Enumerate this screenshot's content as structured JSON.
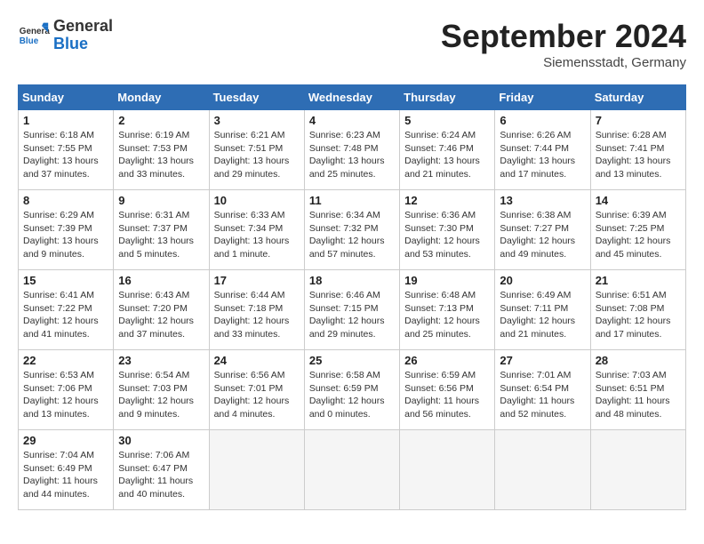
{
  "header": {
    "logo": {
      "general": "General",
      "blue": "Blue"
    },
    "month": "September 2024",
    "location": "Siemensstadt, Germany"
  },
  "days_of_week": [
    "Sunday",
    "Monday",
    "Tuesday",
    "Wednesday",
    "Thursday",
    "Friday",
    "Saturday"
  ],
  "weeks": [
    [
      {
        "num": "1",
        "info": "Sunrise: 6:18 AM\nSunset: 7:55 PM\nDaylight: 13 hours\nand 37 minutes."
      },
      {
        "num": "2",
        "info": "Sunrise: 6:19 AM\nSunset: 7:53 PM\nDaylight: 13 hours\nand 33 minutes."
      },
      {
        "num": "3",
        "info": "Sunrise: 6:21 AM\nSunset: 7:51 PM\nDaylight: 13 hours\nand 29 minutes."
      },
      {
        "num": "4",
        "info": "Sunrise: 6:23 AM\nSunset: 7:48 PM\nDaylight: 13 hours\nand 25 minutes."
      },
      {
        "num": "5",
        "info": "Sunrise: 6:24 AM\nSunset: 7:46 PM\nDaylight: 13 hours\nand 21 minutes."
      },
      {
        "num": "6",
        "info": "Sunrise: 6:26 AM\nSunset: 7:44 PM\nDaylight: 13 hours\nand 17 minutes."
      },
      {
        "num": "7",
        "info": "Sunrise: 6:28 AM\nSunset: 7:41 PM\nDaylight: 13 hours\nand 13 minutes."
      }
    ],
    [
      {
        "num": "8",
        "info": "Sunrise: 6:29 AM\nSunset: 7:39 PM\nDaylight: 13 hours\nand 9 minutes."
      },
      {
        "num": "9",
        "info": "Sunrise: 6:31 AM\nSunset: 7:37 PM\nDaylight: 13 hours\nand 5 minutes."
      },
      {
        "num": "10",
        "info": "Sunrise: 6:33 AM\nSunset: 7:34 PM\nDaylight: 13 hours\nand 1 minute."
      },
      {
        "num": "11",
        "info": "Sunrise: 6:34 AM\nSunset: 7:32 PM\nDaylight: 12 hours\nand 57 minutes."
      },
      {
        "num": "12",
        "info": "Sunrise: 6:36 AM\nSunset: 7:30 PM\nDaylight: 12 hours\nand 53 minutes."
      },
      {
        "num": "13",
        "info": "Sunrise: 6:38 AM\nSunset: 7:27 PM\nDaylight: 12 hours\nand 49 minutes."
      },
      {
        "num": "14",
        "info": "Sunrise: 6:39 AM\nSunset: 7:25 PM\nDaylight: 12 hours\nand 45 minutes."
      }
    ],
    [
      {
        "num": "15",
        "info": "Sunrise: 6:41 AM\nSunset: 7:22 PM\nDaylight: 12 hours\nand 41 minutes."
      },
      {
        "num": "16",
        "info": "Sunrise: 6:43 AM\nSunset: 7:20 PM\nDaylight: 12 hours\nand 37 minutes."
      },
      {
        "num": "17",
        "info": "Sunrise: 6:44 AM\nSunset: 7:18 PM\nDaylight: 12 hours\nand 33 minutes."
      },
      {
        "num": "18",
        "info": "Sunrise: 6:46 AM\nSunset: 7:15 PM\nDaylight: 12 hours\nand 29 minutes."
      },
      {
        "num": "19",
        "info": "Sunrise: 6:48 AM\nSunset: 7:13 PM\nDaylight: 12 hours\nand 25 minutes."
      },
      {
        "num": "20",
        "info": "Sunrise: 6:49 AM\nSunset: 7:11 PM\nDaylight: 12 hours\nand 21 minutes."
      },
      {
        "num": "21",
        "info": "Sunrise: 6:51 AM\nSunset: 7:08 PM\nDaylight: 12 hours\nand 17 minutes."
      }
    ],
    [
      {
        "num": "22",
        "info": "Sunrise: 6:53 AM\nSunset: 7:06 PM\nDaylight: 12 hours\nand 13 minutes."
      },
      {
        "num": "23",
        "info": "Sunrise: 6:54 AM\nSunset: 7:03 PM\nDaylight: 12 hours\nand 9 minutes."
      },
      {
        "num": "24",
        "info": "Sunrise: 6:56 AM\nSunset: 7:01 PM\nDaylight: 12 hours\nand 4 minutes."
      },
      {
        "num": "25",
        "info": "Sunrise: 6:58 AM\nSunset: 6:59 PM\nDaylight: 12 hours\nand 0 minutes."
      },
      {
        "num": "26",
        "info": "Sunrise: 6:59 AM\nSunset: 6:56 PM\nDaylight: 11 hours\nand 56 minutes."
      },
      {
        "num": "27",
        "info": "Sunrise: 7:01 AM\nSunset: 6:54 PM\nDaylight: 11 hours\nand 52 minutes."
      },
      {
        "num": "28",
        "info": "Sunrise: 7:03 AM\nSunset: 6:51 PM\nDaylight: 11 hours\nand 48 minutes."
      }
    ],
    [
      {
        "num": "29",
        "info": "Sunrise: 7:04 AM\nSunset: 6:49 PM\nDaylight: 11 hours\nand 44 minutes."
      },
      {
        "num": "30",
        "info": "Sunrise: 7:06 AM\nSunset: 6:47 PM\nDaylight: 11 hours\nand 40 minutes."
      },
      {
        "num": "",
        "info": ""
      },
      {
        "num": "",
        "info": ""
      },
      {
        "num": "",
        "info": ""
      },
      {
        "num": "",
        "info": ""
      },
      {
        "num": "",
        "info": ""
      }
    ]
  ]
}
